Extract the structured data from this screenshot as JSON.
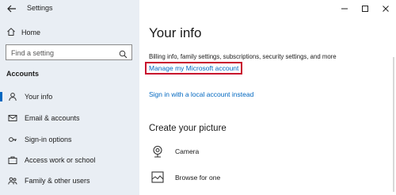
{
  "window": {
    "title": "Settings"
  },
  "sidebar": {
    "home_label": "Home",
    "search_placeholder": "Find a setting",
    "section_title": "Accounts",
    "items": [
      {
        "label": "Your info",
        "icon": "person-icon",
        "selected": true
      },
      {
        "label": "Email & accounts",
        "icon": "mail-icon"
      },
      {
        "label": "Sign-in options",
        "icon": "key-icon"
      },
      {
        "label": "Access work or school",
        "icon": "briefcase-icon"
      },
      {
        "label": "Family & other users",
        "icon": "people-icon"
      }
    ]
  },
  "main": {
    "title": "Your info",
    "description": "Billing info, family settings, subscriptions, security settings, and more",
    "manage_link": "Manage my Microsoft account",
    "local_link": "Sign in with a local account instead",
    "create_picture_title": "Create your picture",
    "picture_options": [
      {
        "label": "Camera",
        "icon": "camera-icon"
      },
      {
        "label": "Browse for one",
        "icon": "browse-icon"
      }
    ]
  },
  "colors": {
    "accent": "#0067c0",
    "highlight_box": "#c8102e",
    "sidebar_bg": "#e9eef4"
  }
}
